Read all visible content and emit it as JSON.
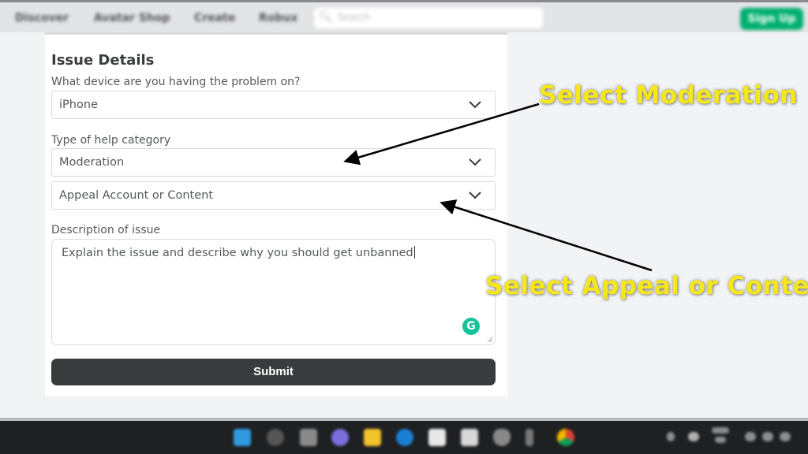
{
  "topnav": {
    "links": [
      "Discover",
      "Avatar Shop",
      "Create",
      "Robux"
    ],
    "search_placeholder": "Search",
    "signup_label": "Sign Up",
    "signup_color": "#00b06f"
  },
  "form": {
    "heading": "Issue Details",
    "device_label": "What device are you having the problem on?",
    "device_value": "iPhone",
    "category_label": "Type of help category",
    "category_value": "Moderation",
    "subcategory_value": "Appeal Account or Content",
    "description_label": "Description of issue",
    "description_value": "Explain the issue and describe why you should get unbanned",
    "grammarly_glyph": "G",
    "submit_label": "Submit"
  },
  "annotations": {
    "first": "Select Moderation",
    "second": "Select Appeal or Content",
    "color": "#f6e71b"
  },
  "taskbar": {
    "icons": [
      "windows-start-icon",
      "search-icon",
      "task-view-icon",
      "chat-icon",
      "file-explorer-icon",
      "edge-icon",
      "store-icon",
      "app-icon",
      "shield-icon",
      "terminal-icon",
      "chrome-icon"
    ]
  }
}
